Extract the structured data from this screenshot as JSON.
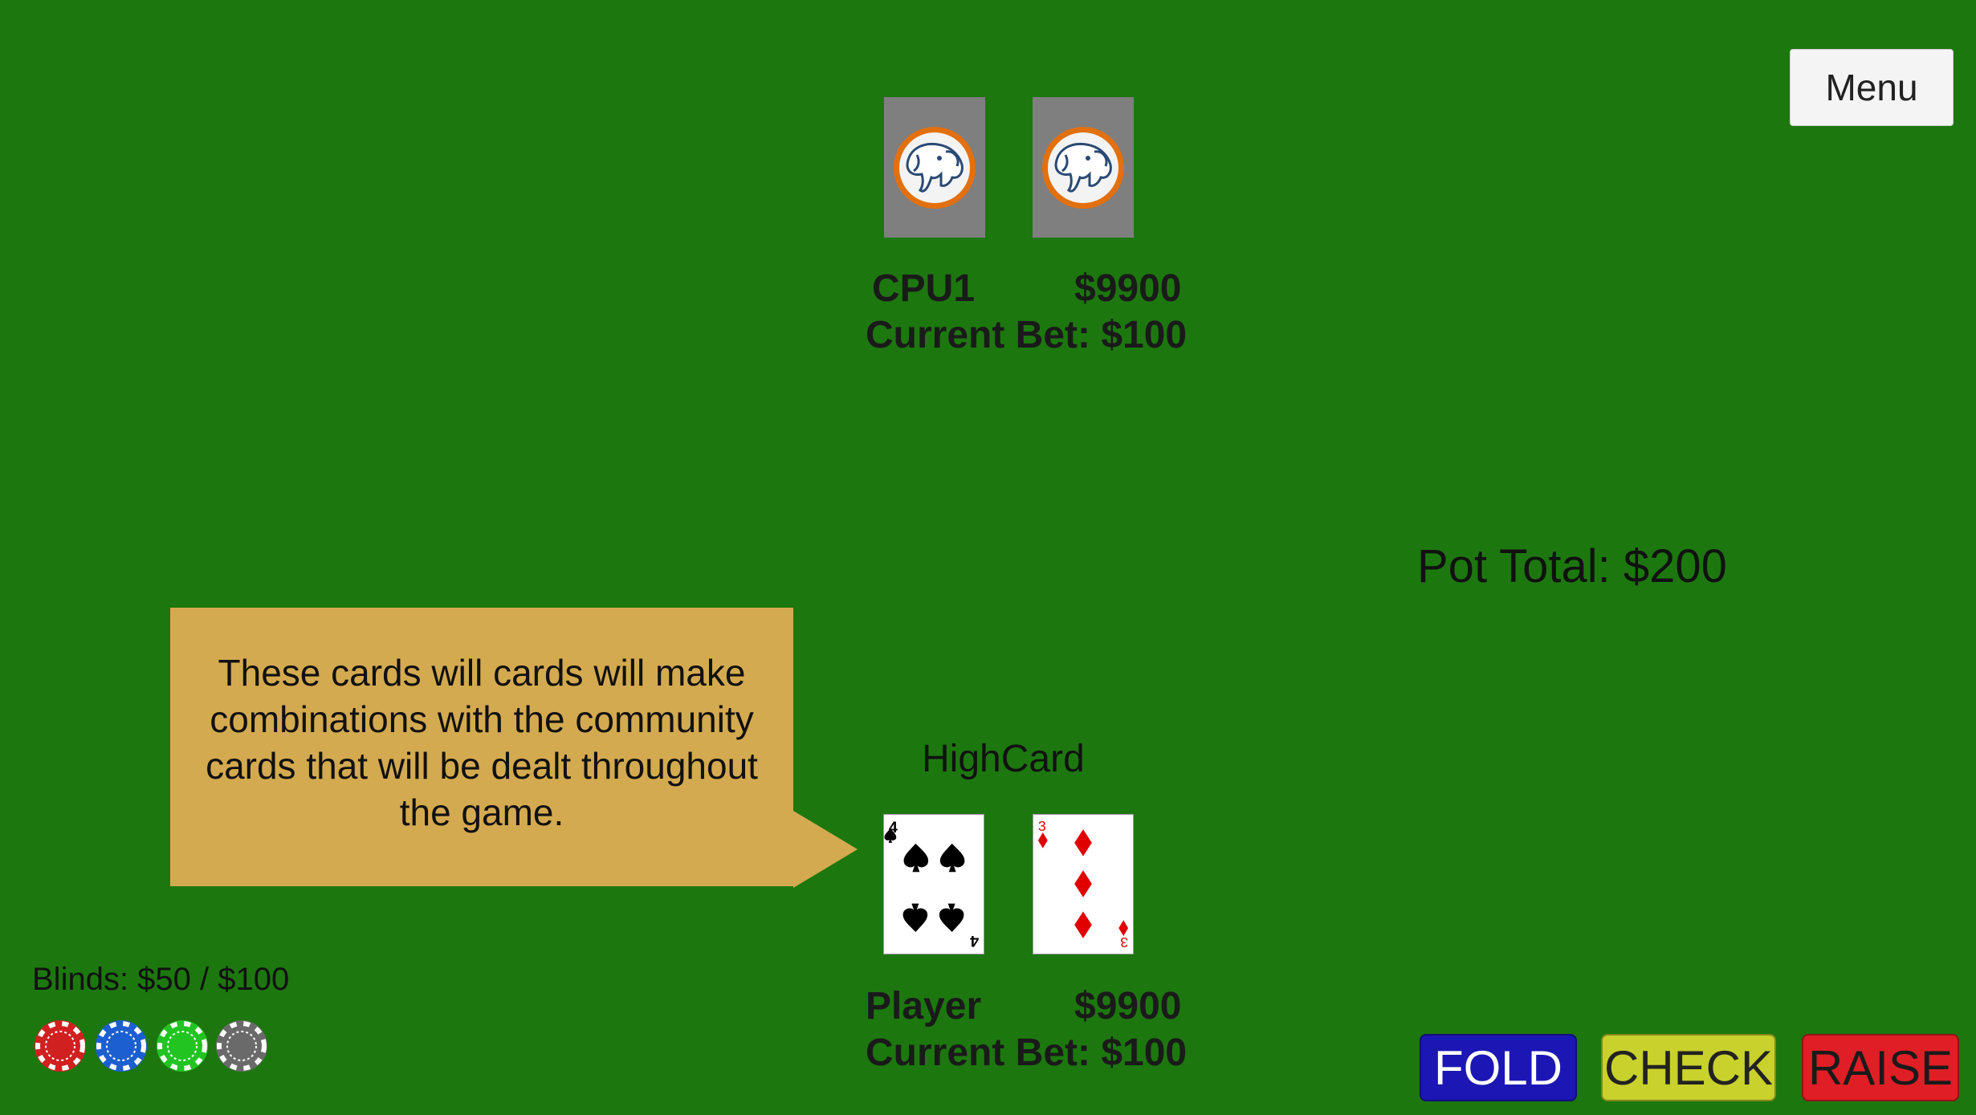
{
  "menu": {
    "label": "Menu"
  },
  "cpu": {
    "name": "CPU1",
    "chips": "$9900",
    "bet_label": "Current Bet: $100"
  },
  "player": {
    "name": "Player",
    "chips": "$9900",
    "bet_label": "Current Bet: $100",
    "hand_rank": "HighCard",
    "cards": [
      {
        "rank": "4",
        "suit": "spades",
        "color": "#000000"
      },
      {
        "rank": "3",
        "suit": "diamonds",
        "color": "#e00000"
      }
    ]
  },
  "pot": {
    "label": "Pot Total: $200"
  },
  "tooltip": {
    "text": "These cards will cards will make combinations with the community cards that will be dealt throughout the game."
  },
  "blinds": {
    "label": "Blinds: $50 / $100"
  },
  "chips": [
    {
      "icon": "red-chip-icon",
      "color": "#d02020"
    },
    {
      "icon": "blue-chip-icon",
      "color": "#1c5fd0"
    },
    {
      "icon": "green-chip-icon",
      "color": "#22c422"
    },
    {
      "icon": "gray-chip-icon",
      "color": "#6a6a6a"
    }
  ],
  "actions": {
    "fold": "FOLD",
    "check": "CHECK",
    "raise": "RAISE"
  },
  "colors": {
    "table": "#1d770f",
    "tooltip": "#d4aa50",
    "card_back": "#7f7f7f",
    "card_back_ring": "#e2700f"
  }
}
